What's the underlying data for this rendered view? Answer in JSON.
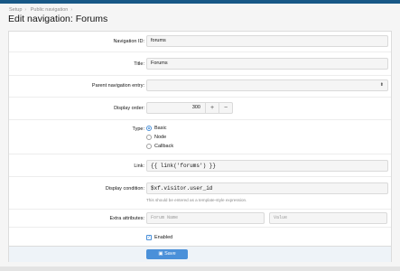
{
  "breadcrumb": [
    "Setup",
    "Public navigation"
  ],
  "page_title": "Edit navigation: Forums",
  "fields": {
    "navigation_id": {
      "label": "Navigation ID:",
      "value": "forums"
    },
    "title": {
      "label": "Title:",
      "value": "Forums"
    },
    "parent": {
      "label": "Parent navigation entry:",
      "value": ""
    },
    "display_order": {
      "label": "Display order:",
      "value": "300",
      "plus": "+",
      "minus": "−"
    },
    "type": {
      "label": "Type:",
      "options": [
        "Basic",
        "Node",
        "Callback"
      ],
      "selected": "Basic"
    },
    "link": {
      "label": "Link:",
      "value": "{{ link('forums') }}"
    },
    "display_condition": {
      "label": "Display condition:",
      "value": "$xf.visitor.user_id",
      "hint": "This should be entered as a template-style expression."
    },
    "extra_attributes": {
      "label": "Extra attributes:",
      "name_placeholder": "Forum Name",
      "value_placeholder": "Value"
    },
    "enabled": {
      "label": "Enabled",
      "checked": true
    }
  },
  "save_button": {
    "label": "Save",
    "icon": "save-icon"
  },
  "colors": {
    "accent": "#4a90d9",
    "topbar": "#185886"
  }
}
